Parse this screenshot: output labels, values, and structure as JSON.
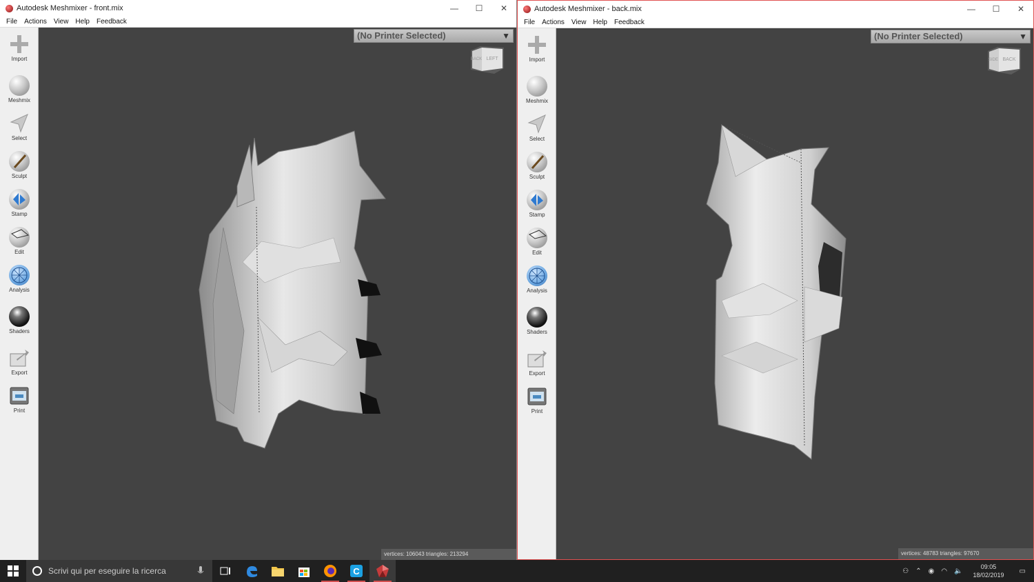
{
  "windows": [
    {
      "title": "Autodesk Meshmixer - front.mix",
      "printer": "(No Printer Selected)",
      "cube_faces": [
        "BACK",
        "LEFT"
      ],
      "status": "vertices: 106043 triangles: 213294"
    },
    {
      "title": "Autodesk Meshmixer - back.mix",
      "printer": "(No Printer Selected)",
      "cube_faces": [
        "SIDE",
        "BACK"
      ],
      "status": "vertices: 48783 triangles: 97670"
    }
  ],
  "menu": [
    "File",
    "Actions",
    "View",
    "Help",
    "Feedback"
  ],
  "tools": [
    "Import",
    "Meshmix",
    "Select",
    "Sculpt",
    "Stamp",
    "Edit",
    "Analysis",
    "Shaders",
    "Export",
    "Print"
  ],
  "window_controls": {
    "minimize": "—",
    "maximize": "☐",
    "close": "✕"
  },
  "taskbar": {
    "search_placeholder": "Scrivi qui per eseguire la ricerca",
    "time": "09:05",
    "date": "18/02/2019"
  },
  "colors": {
    "viewport": "#434343",
    "active_border": "#e05050"
  }
}
